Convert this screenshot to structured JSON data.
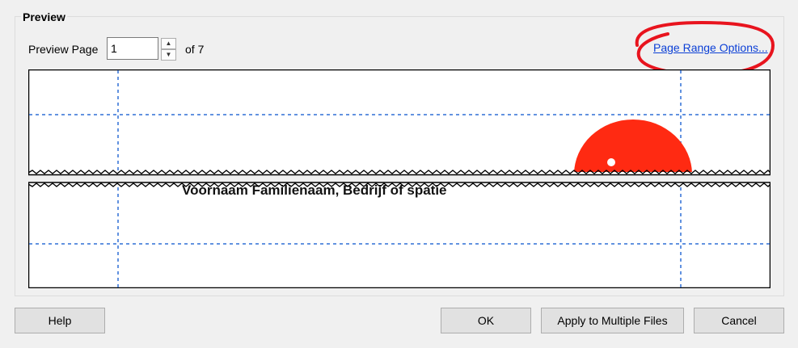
{
  "dialog": {
    "section_title": "Preview",
    "preview_page_label": "Preview Page",
    "preview_page_value": "1",
    "of_label": "of 7",
    "page_range_link": "Page Range Options...",
    "preview_text": "Voornaam Familienaam, Bedrijf of spatie"
  },
  "buttons": {
    "help": "Help",
    "ok": "OK",
    "apply_multiple": "Apply to Multiple Files",
    "cancel": "Cancel"
  },
  "colors": {
    "annotation_circle": "#e8141e",
    "red_shape": "#ff2a12",
    "guide_lines": "#2f6fd6"
  }
}
